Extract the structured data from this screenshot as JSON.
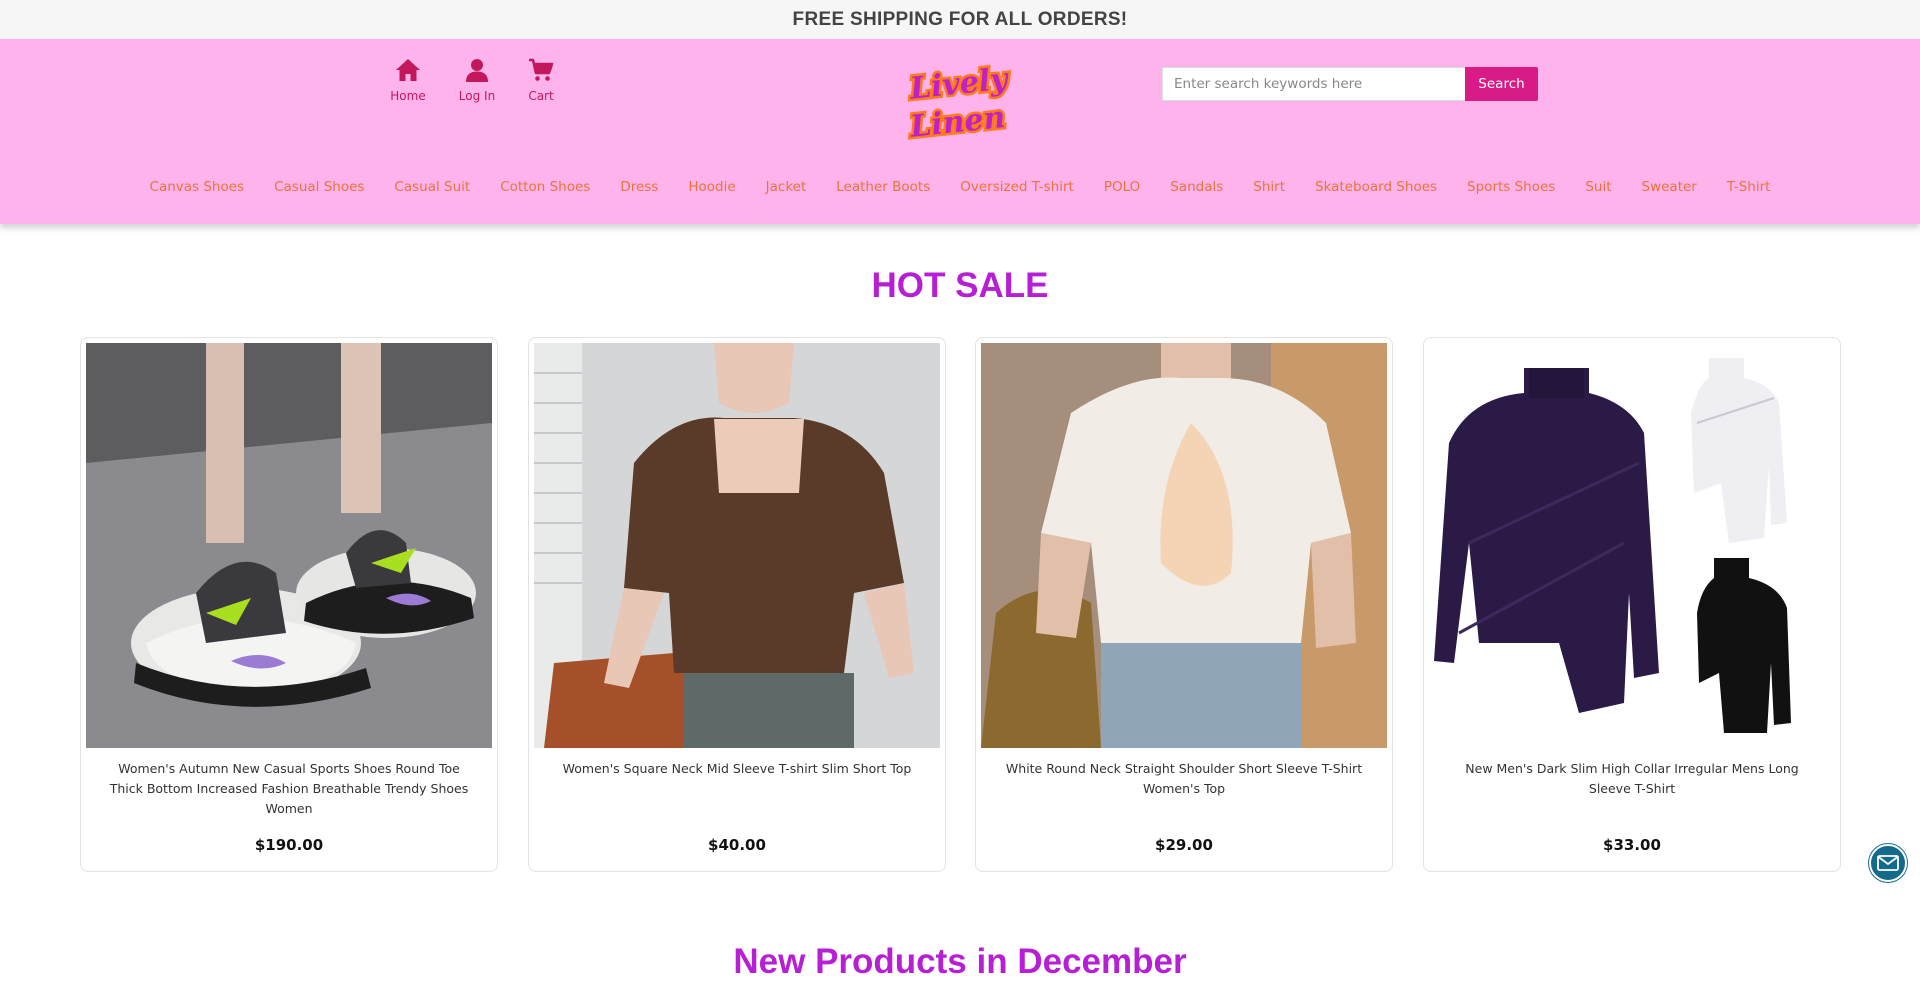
{
  "announcement": "FREE SHIPPING FOR ALL ORDERS!",
  "header": {
    "nav_icons": [
      {
        "label": "Home",
        "icon": "home-icon"
      },
      {
        "label": "Log In",
        "icon": "user-icon"
      },
      {
        "label": "Cart",
        "icon": "cart-icon"
      }
    ],
    "logo_text": "Lively Linen",
    "search": {
      "placeholder": "Enter search keywords here",
      "button_label": "Search"
    },
    "categories": [
      "Canvas Shoes",
      "Casual Shoes",
      "Casual Suit",
      "Cotton Shoes",
      "Dress",
      "Hoodie",
      "Jacket",
      "Leather Boots",
      "Oversized T-shirt",
      "POLO",
      "Sandals",
      "Shirt",
      "Skateboard Shoes",
      "Sports Shoes",
      "Suit",
      "Sweater",
      "T-Shirt"
    ]
  },
  "hot_sale": {
    "title": "HOT SALE",
    "products": [
      {
        "name": "Women's Autumn New Casual Sports Shoes Round Toe Thick Bottom Increased Fashion Breathable Trendy Shoes Women",
        "price": "$190.00"
      },
      {
        "name": "Women's Square Neck Mid Sleeve T-shirt Slim Short Top",
        "price": "$40.00"
      },
      {
        "name": "White Round Neck Straight Shoulder Short Sleeve T-Shirt Women's Top",
        "price": "$29.00"
      },
      {
        "name": "New Men's Dark Slim High Collar Irregular Mens Long Sleeve T-Shirt",
        "price": "$33.00"
      }
    ]
  },
  "new_products": {
    "title": "New Products in December"
  },
  "colors": {
    "header_bg": "#ffb3ec",
    "accent": "#d81b86",
    "category_link": "#e8743b",
    "section_title": "#b61fd4",
    "mail_button": "#136a8a"
  }
}
